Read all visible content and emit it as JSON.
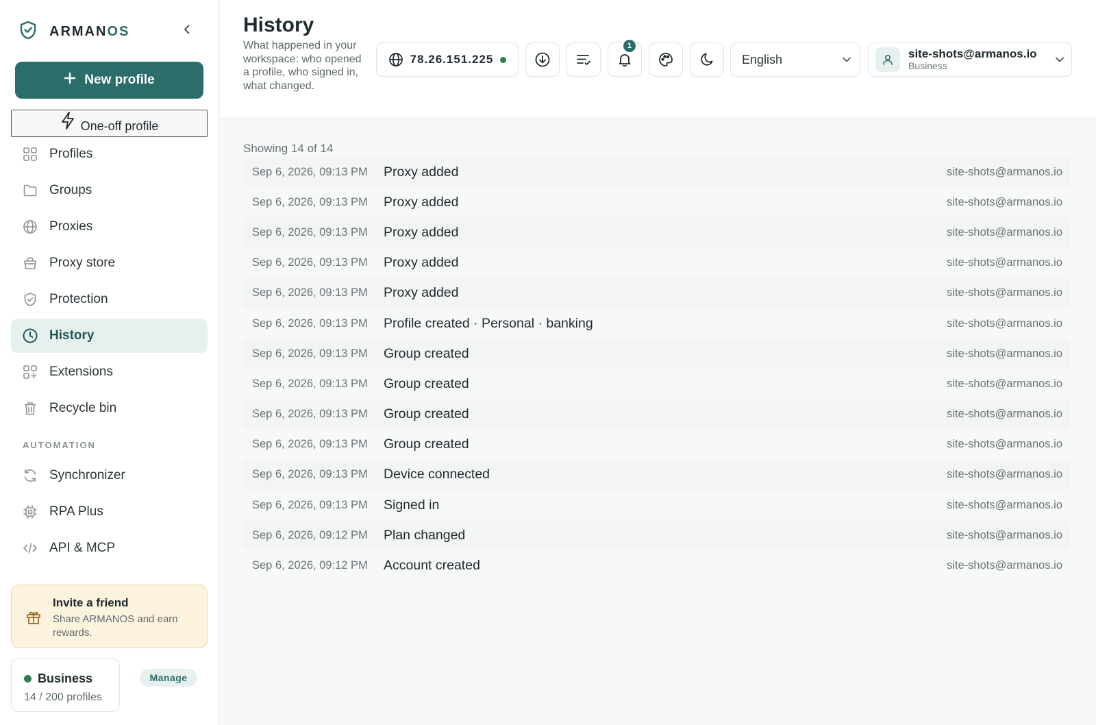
{
  "brand": {
    "name_main": "ARMAN",
    "name_accent": "OS"
  },
  "sidebar": {
    "new_profile_label": "New profile",
    "oneoff_label": "One-off profile",
    "items": [
      {
        "label": "Profiles",
        "icon": "grid-icon"
      },
      {
        "label": "Groups",
        "icon": "folder-icon"
      },
      {
        "label": "Proxies",
        "icon": "globe-icon"
      },
      {
        "label": "Proxy store",
        "icon": "basket-icon"
      },
      {
        "label": "Protection",
        "icon": "shield-check-icon"
      },
      {
        "label": "History",
        "icon": "clock-icon",
        "active": true
      },
      {
        "label": "Extensions",
        "icon": "extensions-icon"
      },
      {
        "label": "Recycle bin",
        "icon": "trash-icon"
      }
    ],
    "section_automation": "AUTOMATION",
    "automation_items": [
      {
        "label": "Synchronizer",
        "icon": "sync-icon"
      },
      {
        "label": "RPA Plus",
        "icon": "chip-icon"
      },
      {
        "label": "API & MCP",
        "icon": "code-icon"
      }
    ],
    "invite": {
      "title": "Invite a friend",
      "subtitle": "Share ARMANOS and earn rewards."
    },
    "plan": {
      "name": "Business",
      "usage": "14 / 200 profiles",
      "manage_label": "Manage"
    }
  },
  "header": {
    "title": "History",
    "subtitle": "What happened in your workspace: who opened a profile, who signed in, what changed.",
    "ip": "78.26.151.225",
    "notifications_count": "1",
    "language": "English",
    "account": {
      "email": "site-shots@armanos.io",
      "plan": "Business"
    }
  },
  "main": {
    "showing": "Showing 14 of 14",
    "rows": [
      {
        "time": "Sep 6, 2026, 09:13 PM",
        "event": "Proxy added",
        "user": "site-shots@armanos.io"
      },
      {
        "time": "Sep 6, 2026, 09:13 PM",
        "event": "Proxy added",
        "user": "site-shots@armanos.io"
      },
      {
        "time": "Sep 6, 2026, 09:13 PM",
        "event": "Proxy added",
        "user": "site-shots@armanos.io"
      },
      {
        "time": "Sep 6, 2026, 09:13 PM",
        "event": "Proxy added",
        "user": "site-shots@armanos.io"
      },
      {
        "time": "Sep 6, 2026, 09:13 PM",
        "event": "Proxy added",
        "user": "site-shots@armanos.io"
      },
      {
        "time": "Sep 6, 2026, 09:13 PM",
        "event": "Profile created · Personal · banking",
        "user": "site-shots@armanos.io"
      },
      {
        "time": "Sep 6, 2026, 09:13 PM",
        "event": "Group created",
        "user": "site-shots@armanos.io"
      },
      {
        "time": "Sep 6, 2026, 09:13 PM",
        "event": "Group created",
        "user": "site-shots@armanos.io"
      },
      {
        "time": "Sep 6, 2026, 09:13 PM",
        "event": "Group created",
        "user": "site-shots@armanos.io"
      },
      {
        "time": "Sep 6, 2026, 09:13 PM",
        "event": "Group created",
        "user": "site-shots@armanos.io"
      },
      {
        "time": "Sep 6, 2026, 09:13 PM",
        "event": "Device connected",
        "user": "site-shots@armanos.io"
      },
      {
        "time": "Sep 6, 2026, 09:13 PM",
        "event": "Signed in",
        "user": "site-shots@armanos.io"
      },
      {
        "time": "Sep 6, 2026, 09:12 PM",
        "event": "Plan changed",
        "user": "site-shots@armanos.io"
      },
      {
        "time": "Sep 6, 2026, 09:12 PM",
        "event": "Account created",
        "user": "site-shots@armanos.io"
      }
    ]
  },
  "colors": {
    "accent": "#2a6d69",
    "active_bg": "#e6f0ef",
    "status_green": "#2e7d4f",
    "invite_bg": "#fcf3de"
  }
}
